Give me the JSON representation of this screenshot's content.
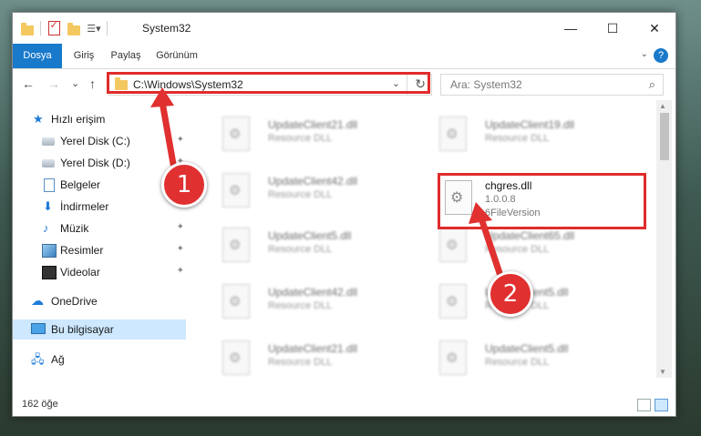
{
  "window": {
    "title": "System32",
    "controls": {
      "minimize": "—",
      "maximize": "☐",
      "close": "✕"
    }
  },
  "ribbon": {
    "tabs": [
      "Dosya",
      "Giriş",
      "Paylaş",
      "Görünüm"
    ],
    "help": "?"
  },
  "nav": {
    "back": "←",
    "forward": "→",
    "recent": "⌄",
    "up": "↑",
    "address": "C:\\Windows\\System32",
    "address_dropdown": "⌄",
    "refresh": "↻",
    "search_placeholder": "Ara: System32",
    "search_glyph": "⌕"
  },
  "sidebar": {
    "items": [
      {
        "label": "Hızlı erişim",
        "icon": "star-icon",
        "pinned": false
      },
      {
        "label": "Yerel Disk (C:)",
        "icon": "disk-icon",
        "pinned": true
      },
      {
        "label": "Yerel Disk (D:)",
        "icon": "disk-icon",
        "pinned": true
      },
      {
        "label": "Belgeler",
        "icon": "document-icon",
        "pinned": true
      },
      {
        "label": "İndirmeler",
        "icon": "download-icon",
        "pinned": true
      },
      {
        "label": "Müzik",
        "icon": "music-icon",
        "pinned": true
      },
      {
        "label": "Resimler",
        "icon": "picture-icon",
        "pinned": true
      },
      {
        "label": "Videolar",
        "icon": "video-icon",
        "pinned": true
      },
      {
        "label": "OneDrive",
        "icon": "onedrive-icon",
        "pinned": false
      },
      {
        "label": "Bu bilgisayar",
        "icon": "computer-icon",
        "pinned": false,
        "selected": true
      },
      {
        "label": "Ağ",
        "icon": "network-icon",
        "pinned": false
      }
    ],
    "pin_glyph": "✦"
  },
  "files": [
    {
      "name": "UpdateClient21.dll",
      "type": "Resource DLL"
    },
    {
      "name": "UpdateClient19.dll",
      "type": "Resource DLL"
    },
    {
      "name": "UpdateClient42.dll",
      "type": "Resource DLL"
    },
    {
      "name": "UpdateClient5.dll",
      "type": "Resource DLL"
    },
    {
      "name": "UpdateClient65.dll",
      "type": "Resource DLL"
    },
    {
      "name": "UpdateClient42.dll",
      "type": "Resource DLL"
    },
    {
      "name": "UpdateClient5.dll",
      "type": "Resource DLL"
    },
    {
      "name": "UpdateClient21.dll",
      "type": "Resource DLL"
    },
    {
      "name": "UpdateClient5.dll",
      "type": "Resource DLL"
    }
  ],
  "highlighted_file": {
    "name": "chgres.dll",
    "version": "1.0.0.8",
    "type": "6FileVersion"
  },
  "callouts": [
    "1",
    "2"
  ],
  "status": {
    "item_count": "162 öğe"
  },
  "colors": {
    "accent": "#1979ca",
    "highlight": "#e02b2b",
    "selection": "#cde8ff"
  }
}
